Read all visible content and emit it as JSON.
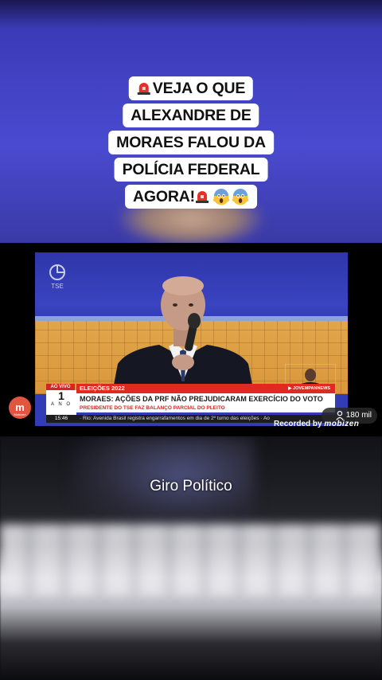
{
  "title_card": {
    "line1": "VEJA O QUE",
    "line2": "ALEXANDRE DE",
    "line3": "MORAES FALOU DA",
    "line4": "POLÍCIA FEDERAL",
    "line5": "AGORA!",
    "icons": [
      "siren-icon",
      "screaming-face-icon"
    ]
  },
  "broadcast": {
    "live_label": "AO VIVO",
    "anniversary_number": "1",
    "anniversary_word": "A N O",
    "time": "15:46",
    "tag": "ELEIÇÕES 2022",
    "channel": "JOVEMPANNEWS",
    "headline": "MORAES: AÇÕES DA PRF NÃO PREJUDICARAM EXERCÍCIO DO VOTO",
    "subheadline": "PRESIDENTE DO TSE FAZ BALANÇO PARCIAL DO PLEITO",
    "ticker": "· Rio: Avenida Brasil registra engarrafamentos em dia de 2º turno das eleições · Ao",
    "tse_logo": "TSE"
  },
  "overlay": {
    "recorder_badge": "m",
    "recorder_badge_sub": "Mobizen",
    "view_count": "180 mil",
    "recorded_by": "Recorded by",
    "recorder_brand": "mobizen"
  },
  "caption": "Giro Político",
  "colors": {
    "accent_red": "#d8241f",
    "background_blue": "#4a4ad0",
    "recorder_orange": "#e2553f"
  }
}
